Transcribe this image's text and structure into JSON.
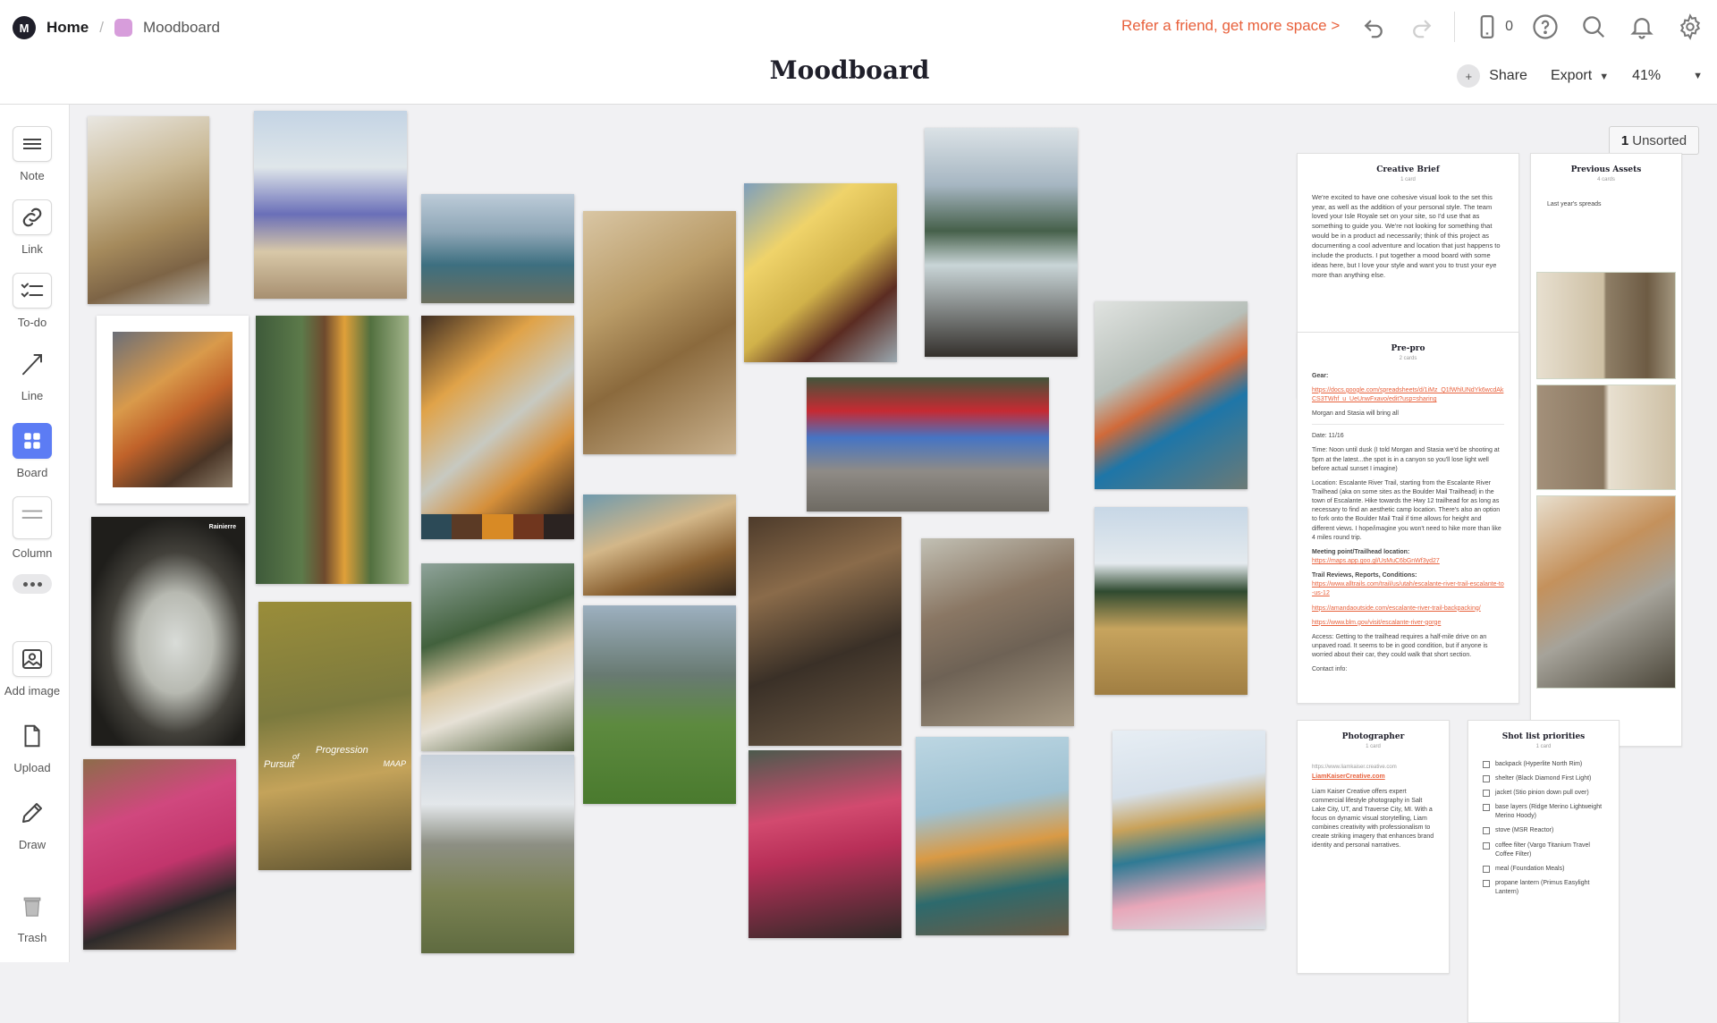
{
  "header": {
    "home_label": "Home",
    "logo_glyph": "M",
    "board_name": "Moodboard",
    "refer_text": "Refer a friend, get more space >",
    "device_count": "0",
    "title": "Moodboard",
    "share_label": "Share",
    "export_label": "Export",
    "zoom_label": "41%",
    "icons": [
      "undo-icon",
      "redo-icon",
      "mobile-device-icon",
      "help-icon",
      "search-icon",
      "bell-icon",
      "settings-icon"
    ]
  },
  "toolbar": {
    "note": "Note",
    "link": "Link",
    "todo": "To-do",
    "line": "Line",
    "board": "Board",
    "column": "Column",
    "add_image": "Add image",
    "upload": "Upload",
    "draw": "Draw",
    "trash": "Trash"
  },
  "unsorted": {
    "count": "1",
    "label": "Unsorted"
  },
  "cards": {
    "creative_brief": {
      "title": "Creative Brief",
      "sub": "1 card",
      "body": "We're excited to have one cohesive visual look to the set this year, as well as the addition of your personal style. The team loved your Isle Royale set on your site, so I'd use that as something to guide you. We're not looking for something that would be in a product ad necessarily; think of this project as documenting a cool adventure and location that just happens to include the products. I put together a mood board with some ideas here, but I love your style and want you to trust your eye more than anything else."
    },
    "previous_assets": {
      "title": "Previous Assets",
      "sub": "4 cards",
      "note": "Last year's spreads"
    },
    "pre_pro": {
      "title": "Pre-pro",
      "sub": "2 cards",
      "gear_label": "Gear:",
      "gear_link": "https://docs.google.com/spreadsheets/d/1iMz_Q1fWhlUNdYk6wcdAkCS3TWhf_u_UeUnwFxavo/edit?usp=sharing",
      "gear_note": "Morgan and Stasia will bring all",
      "date": "Date: 11/16",
      "time": "Time: Noon until dusk (I told Morgan and Stasia we'd be shooting at 5pm at the latest...the spot is in a canyon so you'll lose light well before actual sunset I imagine)",
      "location": "Location: Escalante River Trail, starting from the Escalante River Trailhead (aka on some sites as the Boulder Mail Trailhead) in the town of Escalante. Hike towards the Hwy 12 trailhead for as long as necessary to find an aesthetic camp location. There's also an option to fork onto the Boulder Mail Trail if time allows for height and different views. I hope/imagine you won't need to hike more than like 4 miles round trip.",
      "meeting_label": "Meeting point/Trailhead location:",
      "meeting_link": "https://maps.app.goo.gl/UsMuC6bGnWf3yd27",
      "trail_label": "Trail Reviews, Reports, Conditions:",
      "trail_link_1": "https://www.alltrails.com/trail/us/utah/escalante-river-trail-escalante-to-us-12",
      "trail_link_2": "https://amandaoutside.com/escalante-river-trail-backpacking/",
      "trail_link_3": "https://www.blm.gov/visit/escalante-river-gorge",
      "access": "Access: Getting to the trailhead requires a half-mile drive on an unpaved road. It seems to be in good condition, but if anyone is worried about their car, they could walk that short section.",
      "contact": "Contact info:"
    },
    "photographer": {
      "title": "Photographer",
      "sub": "1 card",
      "url": "https://www.liamkaiser.creative.com",
      "link": "LiamKaiserCreative.com",
      "body": "Liam Kaiser Creative offers expert commercial lifestyle photography in Salt Lake City, UT, and Traverse City, MI. With a focus on dynamic visual storytelling, Liam combines creativity with professionalism to create striking imagery that enhances brand identity and personal narratives."
    },
    "shot_list": {
      "title": "Shot list priorities",
      "sub": "1 card",
      "items": [
        "backpack (Hyperlite North Rim)",
        "shelter (Black Diamond First Light)",
        "jacket (Stio pinion down pull over)",
        "base layers (Ridge Merino Lightweight Merino Hoody)",
        "stove (MSR Reactor)",
        "coffee filter (Vargo Titanium Travel Coffee Filter)",
        "meal (Foundation Meals)",
        "propane lantern (Primus Easylight Lantern)"
      ]
    }
  },
  "photo_overlays": {
    "tent_brand": "Rainierre",
    "poster_line_1": "Pursuit",
    "poster_line_2": "of",
    "poster_line_3": "Progression",
    "poster_brand": "MAAP"
  },
  "colors": {
    "accent": "#e8613c",
    "board_tool": "#5c7cf4",
    "board_swatch": "#d79ddb"
  }
}
